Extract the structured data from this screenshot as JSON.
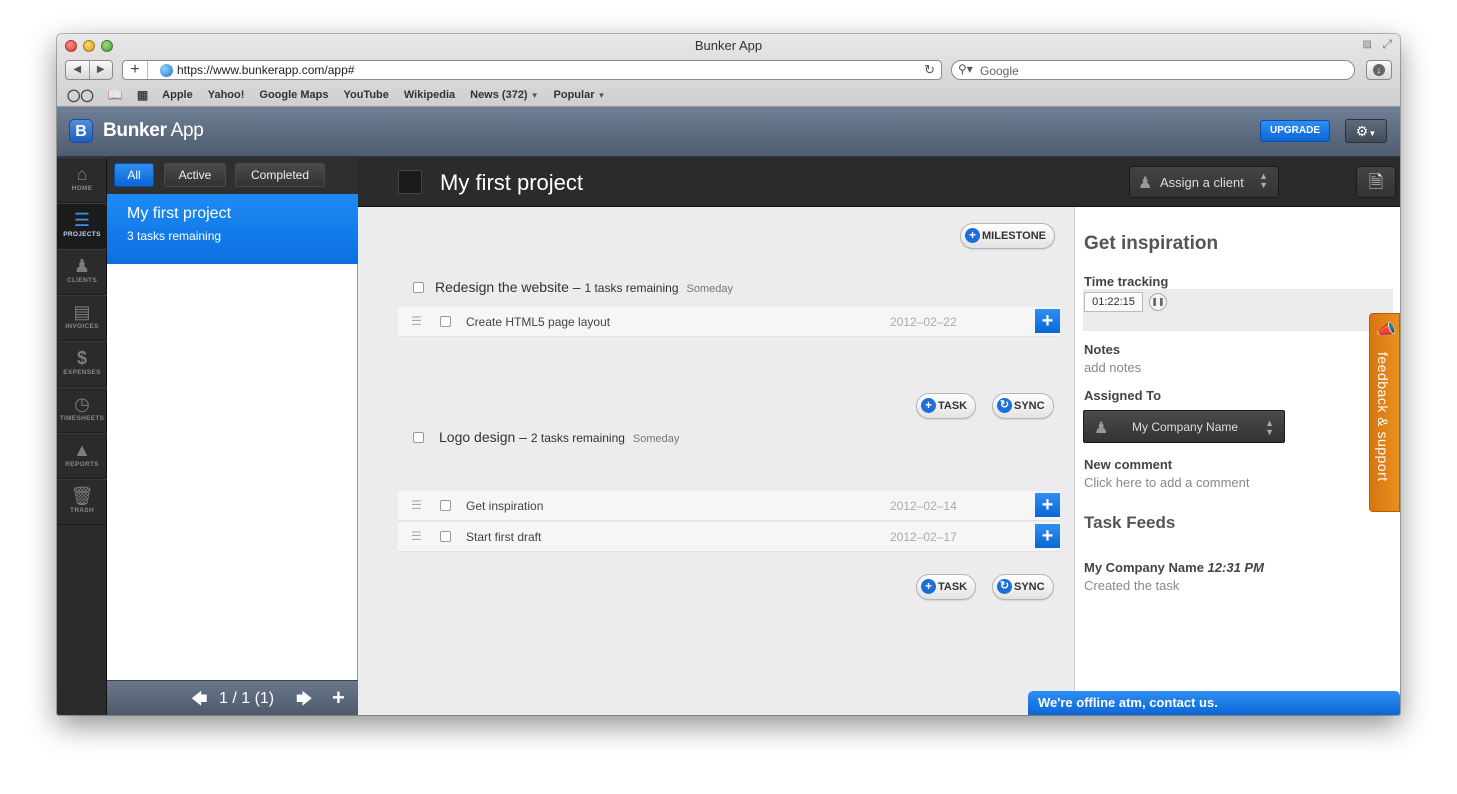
{
  "browser": {
    "window_title": "Bunker App",
    "url": "https://www.bunkerapp.com/app#",
    "search_placeholder": "Google",
    "bookmarks": [
      "Apple",
      "Yahoo!",
      "Google Maps",
      "YouTube",
      "Wikipedia",
      "News (372)",
      "Popular"
    ]
  },
  "app": {
    "logo_letter": "B",
    "name_bold": "Bunker",
    "name_light": " App",
    "upgrade_label": "UPGRADE"
  },
  "nav": {
    "items": [
      {
        "label": "HOME",
        "icon": "home-icon"
      },
      {
        "label": "PROJECTS",
        "icon": "list-icon"
      },
      {
        "label": "CLIENTS",
        "icon": "person-icon"
      },
      {
        "label": "INVOICES",
        "icon": "invoice-icon"
      },
      {
        "label": "EXPENSES",
        "icon": "dollar-icon"
      },
      {
        "label": "TIMESHEETS",
        "icon": "clock-icon"
      },
      {
        "label": "REPORTS",
        "icon": "chart-icon"
      },
      {
        "label": "TRASH",
        "icon": "trash-icon"
      }
    ],
    "active": "PROJECTS"
  },
  "projects": {
    "filters": [
      "All",
      "Active",
      "Completed"
    ],
    "active_filter": "All",
    "list": [
      {
        "name": "My first project",
        "remaining": "3 tasks remaining"
      }
    ],
    "pager_text": "1 / 1 (1)"
  },
  "project": {
    "title": "My first project",
    "assign_client_label": "Assign a client",
    "milestone_button": "MILESTONE",
    "task_button": "TASK",
    "sync_button": "SYNC",
    "milestones": [
      {
        "name": "Redesign the website",
        "remaining": "1 tasks remaining",
        "when": "Someday",
        "tasks": [
          {
            "name": "Create HTML5 page layout",
            "date": "2012–02–22"
          }
        ]
      },
      {
        "name": "Logo design",
        "remaining": "2 tasks remaining",
        "when": "Someday",
        "tasks": [
          {
            "name": "Get inspiration",
            "date": "2012–02–14"
          },
          {
            "name": "Start first draft",
            "date": "2012–02–17"
          }
        ]
      }
    ]
  },
  "detail": {
    "title": "Get inspiration",
    "time_tracking_label": "Time tracking",
    "time_value": "01:22:15",
    "notes_label": "Notes",
    "notes_placeholder": "add notes",
    "assigned_label": "Assigned To",
    "assigned_value": "My Company Name",
    "comment_label": "New comment",
    "comment_placeholder": "Click here to add a comment",
    "feeds_label": "Task Feeds",
    "feed": {
      "author": "My Company Name",
      "time": "12:31 PM",
      "text": "Created the task"
    }
  },
  "feedback_label": "feedback & support",
  "offline_label": "We're offline atm, contact us.",
  "colors": {
    "accent": "#0c6fe0",
    "feedback": "#e08a1a",
    "dark": "#2b2b2b"
  }
}
